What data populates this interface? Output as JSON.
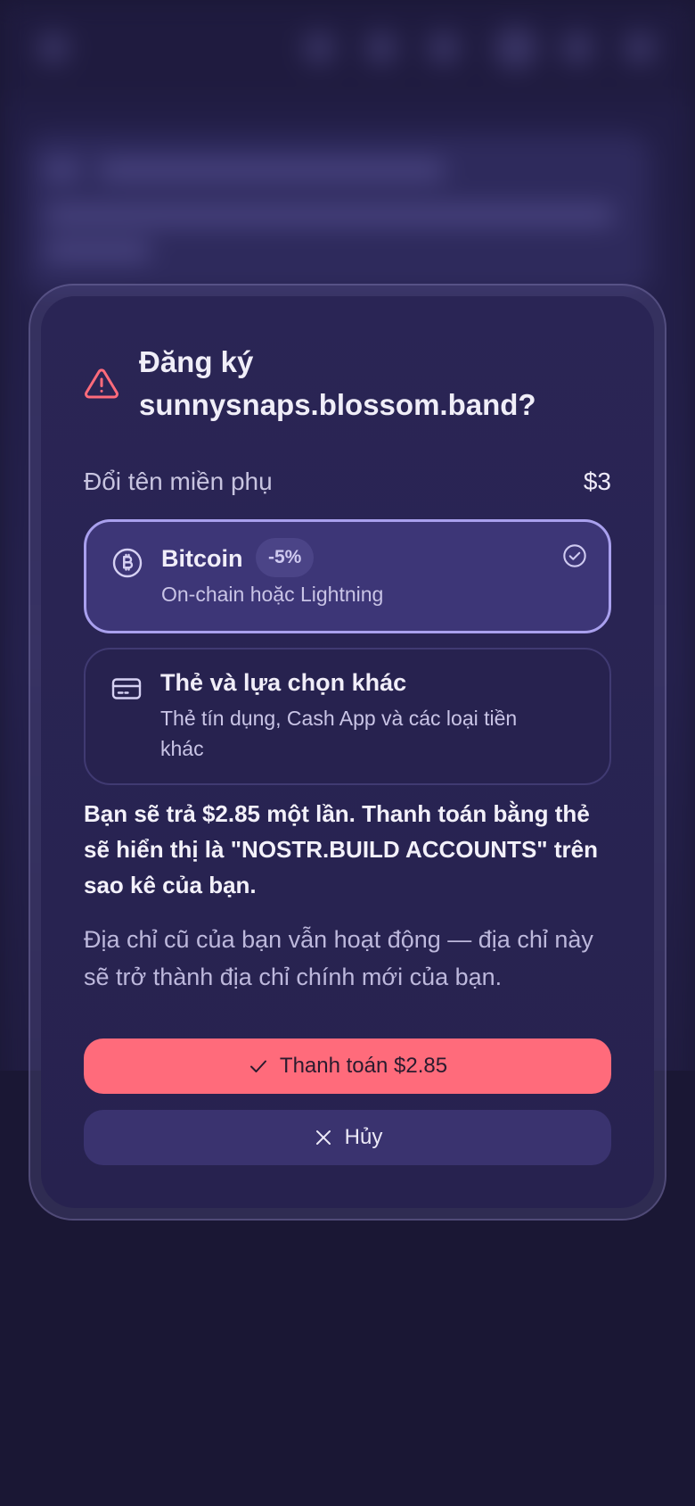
{
  "dialog": {
    "title": "Đăng ký sunnysnaps.blossom.band?",
    "line_label": "Đổi tên miền phụ",
    "line_price": "$3"
  },
  "options": [
    {
      "title": "Bitcoin",
      "badge": "-5%",
      "subtitle": "On-chain hoặc Lightning",
      "icon": "bitcoin-icon",
      "selected": true
    },
    {
      "title": "Thẻ và lựa chọn khác",
      "subtitle": "Thẻ tín dụng, Cash App và các loại tiền khác",
      "icon": "credit-card-icon",
      "selected": false
    }
  ],
  "info": {
    "bold": "Bạn sẽ trả $2.85 một lần. Thanh toán bằng thẻ sẽ hiển thị là \"NOSTR.BUILD ACCOUNTS\" trên sao kê của bạn.",
    "note": "Địa chỉ cũ của bạn vẫn hoạt động — địa chỉ này sẽ trở thành địa chỉ chính mới của bạn."
  },
  "buttons": {
    "pay": "Thanh toán $2.85",
    "cancel": "Hủy"
  },
  "colors": {
    "accent": "#ff6b7b",
    "selected_border": "#a9a0ee",
    "warning": "#ff6b7b",
    "background": "#1a1734"
  }
}
